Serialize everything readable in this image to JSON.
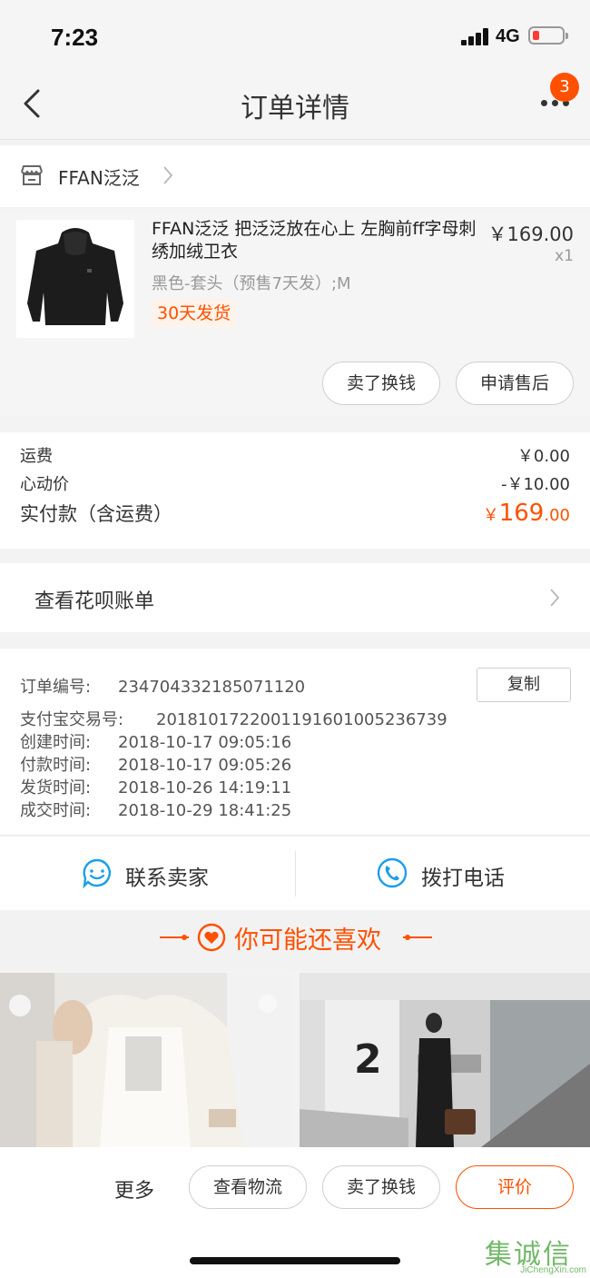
{
  "status": {
    "time": "7:23",
    "network": "4G"
  },
  "nav": {
    "title": "订单详情",
    "badge": "3"
  },
  "shop": {
    "name": "FFAN泛泛"
  },
  "product": {
    "name": "FFAN泛泛 把泛泛放在心上 左胸前ff字母刺绣加绒卫衣",
    "price": "￥169.00",
    "qty": "x1",
    "sku": "黑色-套头（预售7天发）;M",
    "tag": "30天发货",
    "btn_sell": "卖了换钱",
    "btn_aftersale": "申请售后"
  },
  "costs": {
    "shipping_label": "运费",
    "shipping_value": "￥0.00",
    "heart_price_label": "心动价",
    "heart_price_value": "-￥10.00",
    "total_label": "实付款（含运费）",
    "total_currency": "￥",
    "total_int": "169",
    "total_dec": ".00"
  },
  "huabei": {
    "label": "查看花呗账单"
  },
  "order_info": {
    "order_no_label": "订单编号:",
    "order_no": "234704332185071120",
    "copy_label": "复制",
    "alipay_label": "支付宝交易号:",
    "alipay_no": "2018101722001191601005236739",
    "created_label": "创建时间:",
    "created": "2018-10-17 09:05:16",
    "paid_label": "付款时间:",
    "paid": "2018-10-17 09:05:26",
    "shipped_label": "发货时间:",
    "shipped": "2018-10-26 14:19:11",
    "done_label": "成交时间:",
    "done": "2018-10-29 18:41:25"
  },
  "contact": {
    "seller_label": "联系卖家",
    "phone_label": "拨打电话"
  },
  "recommend": {
    "title": "你可能还喜欢"
  },
  "bottom": {
    "more": "更多",
    "logistics": "查看物流",
    "sell": "卖了换钱",
    "review": "评价"
  },
  "watermark": {
    "text": "集诚信",
    "sub": "JiChengXin.com"
  },
  "colors": {
    "accent": "#ff5000",
    "icon_blue": "#1aa0e6"
  }
}
